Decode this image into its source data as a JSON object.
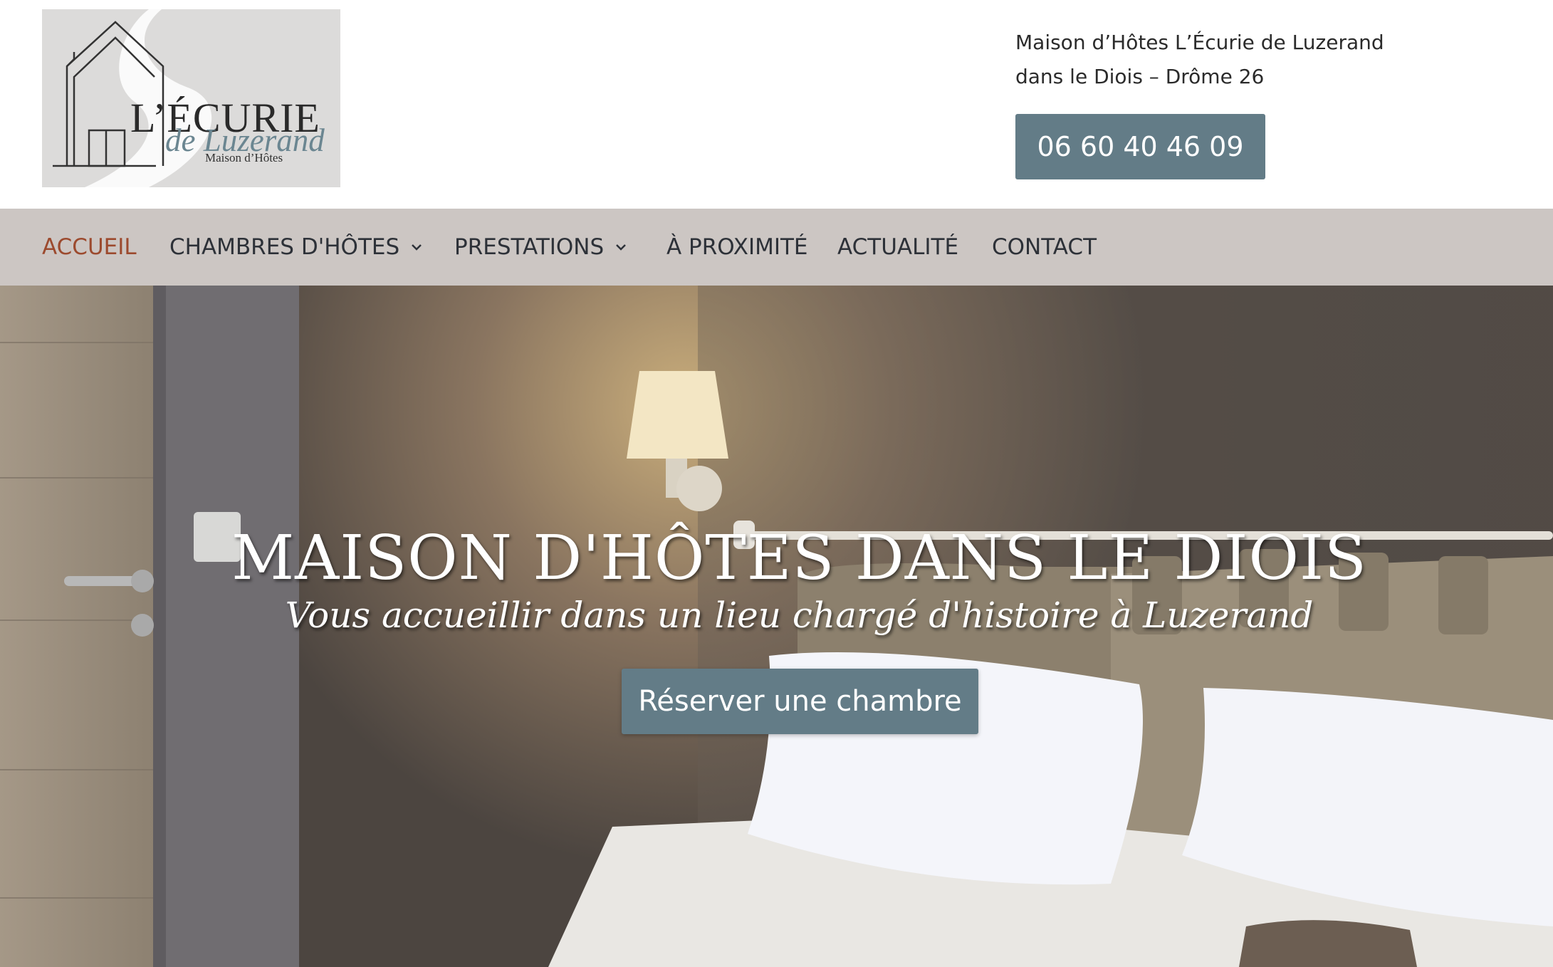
{
  "header": {
    "logo": {
      "title": "L’ÉCURIE",
      "subtitle": "de Luzerand",
      "tagline": "Maison d’Hôtes"
    },
    "address_line_1": "Maison d’Hôtes L’Écurie de Luzerand",
    "address_line_2": "dans le Diois – Drôme 26",
    "phone": "06 60 40 46 09"
  },
  "nav": {
    "items": [
      {
        "label": "ACCUEIL",
        "active": true
      },
      {
        "label": "CHAMBRES D'HÔTES",
        "has_dropdown": true
      },
      {
        "label": "PRESTATIONS",
        "has_dropdown": true
      },
      {
        "label": "À PROXIMITÉ"
      },
      {
        "label": "ACTUALITÉ"
      },
      {
        "label": "CONTACT"
      }
    ]
  },
  "hero": {
    "title": "MAISON D'HÔTES DANS LE DIOIS",
    "subtitle": "Vous accueillir dans un lieu chargé d'histoire à Luzerand",
    "cta_label": "Réserver une chambre",
    "background": "bedroom-photo"
  },
  "colors": {
    "accent": "#637c87",
    "nav_background": "#ccc6c3",
    "nav_active": "#9c4a2e",
    "nav_text": "#2d3138"
  }
}
